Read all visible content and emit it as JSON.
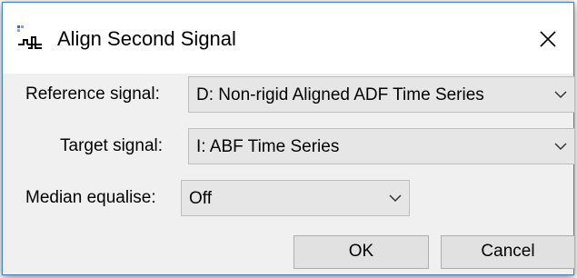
{
  "window": {
    "title": "Align Second Signal",
    "app_icon": "signal-align-app-icon",
    "close_icon": "close-icon"
  },
  "form": {
    "reference": {
      "label": "Reference signal:",
      "value": "D: Non-rigid Aligned ADF Time Series"
    },
    "target": {
      "label": "Target signal:",
      "value": "I: ABF Time Series"
    },
    "median": {
      "label": "Median equalise:",
      "value": "Off"
    }
  },
  "buttons": {
    "ok_label": "OK",
    "cancel_label": "Cancel"
  },
  "colors": {
    "window_border": "#3d7fd1",
    "dialog_background": "#f0f0f0",
    "combo_background": "#e6e6e6",
    "button_background": "#e1e1e1"
  }
}
